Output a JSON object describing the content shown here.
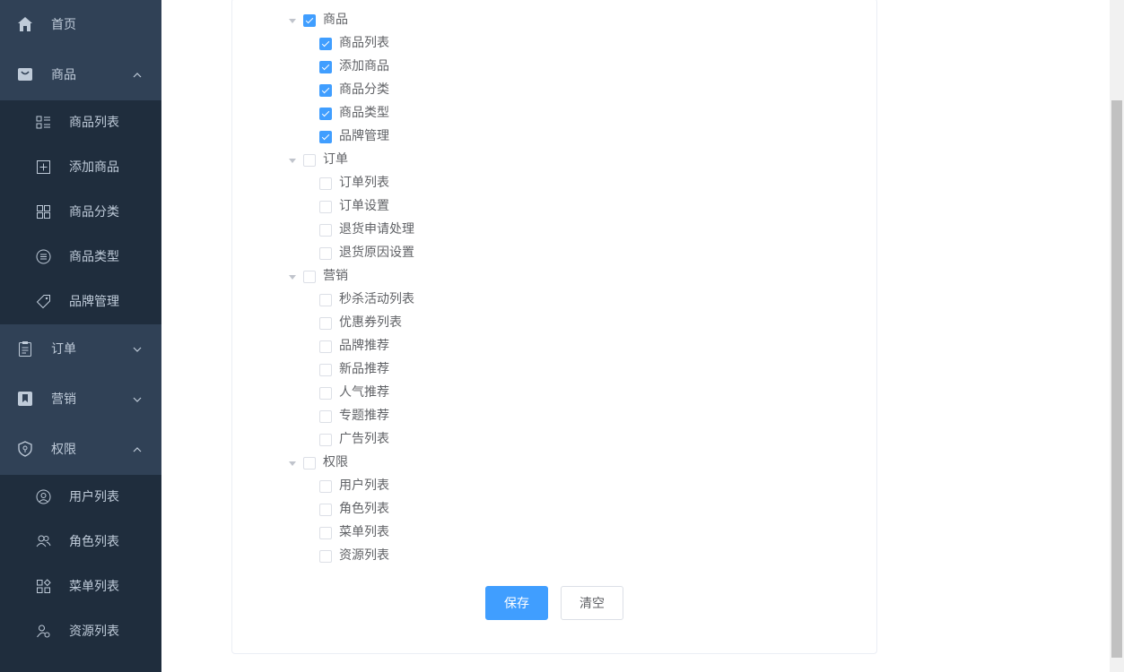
{
  "sidebar": {
    "home": "首页",
    "goods": {
      "label": "商品",
      "items": [
        "商品列表",
        "添加商品",
        "商品分类",
        "商品类型",
        "品牌管理"
      ]
    },
    "order": {
      "label": "订单"
    },
    "marketing": {
      "label": "营销"
    },
    "permission": {
      "label": "权限",
      "items": [
        "用户列表",
        "角色列表",
        "菜单列表",
        "资源列表"
      ]
    }
  },
  "tree": [
    {
      "label": "商品",
      "checked": true,
      "children": [
        {
          "label": "商品列表",
          "checked": true
        },
        {
          "label": "添加商品",
          "checked": true
        },
        {
          "label": "商品分类",
          "checked": true
        },
        {
          "label": "商品类型",
          "checked": true
        },
        {
          "label": "品牌管理",
          "checked": true
        }
      ]
    },
    {
      "label": "订单",
      "checked": false,
      "children": [
        {
          "label": "订单列表",
          "checked": false
        },
        {
          "label": "订单设置",
          "checked": false
        },
        {
          "label": "退货申请处理",
          "checked": false
        },
        {
          "label": "退货原因设置",
          "checked": false
        }
      ]
    },
    {
      "label": "营销",
      "checked": false,
      "children": [
        {
          "label": "秒杀活动列表",
          "checked": false
        },
        {
          "label": "优惠券列表",
          "checked": false
        },
        {
          "label": "品牌推荐",
          "checked": false
        },
        {
          "label": "新品推荐",
          "checked": false
        },
        {
          "label": "人气推荐",
          "checked": false
        },
        {
          "label": "专题推荐",
          "checked": false
        },
        {
          "label": "广告列表",
          "checked": false
        }
      ]
    },
    {
      "label": "权限",
      "checked": false,
      "children": [
        {
          "label": "用户列表",
          "checked": false
        },
        {
          "label": "角色列表",
          "checked": false
        },
        {
          "label": "菜单列表",
          "checked": false
        },
        {
          "label": "资源列表",
          "checked": false
        }
      ]
    }
  ],
  "buttons": {
    "save": "保存",
    "clear": "清空"
  },
  "colors": {
    "sidebar_bg": "#304156",
    "submenu_bg": "#1f2d3d",
    "menu_text": "#bfcbd9",
    "primary": "#409eff"
  }
}
